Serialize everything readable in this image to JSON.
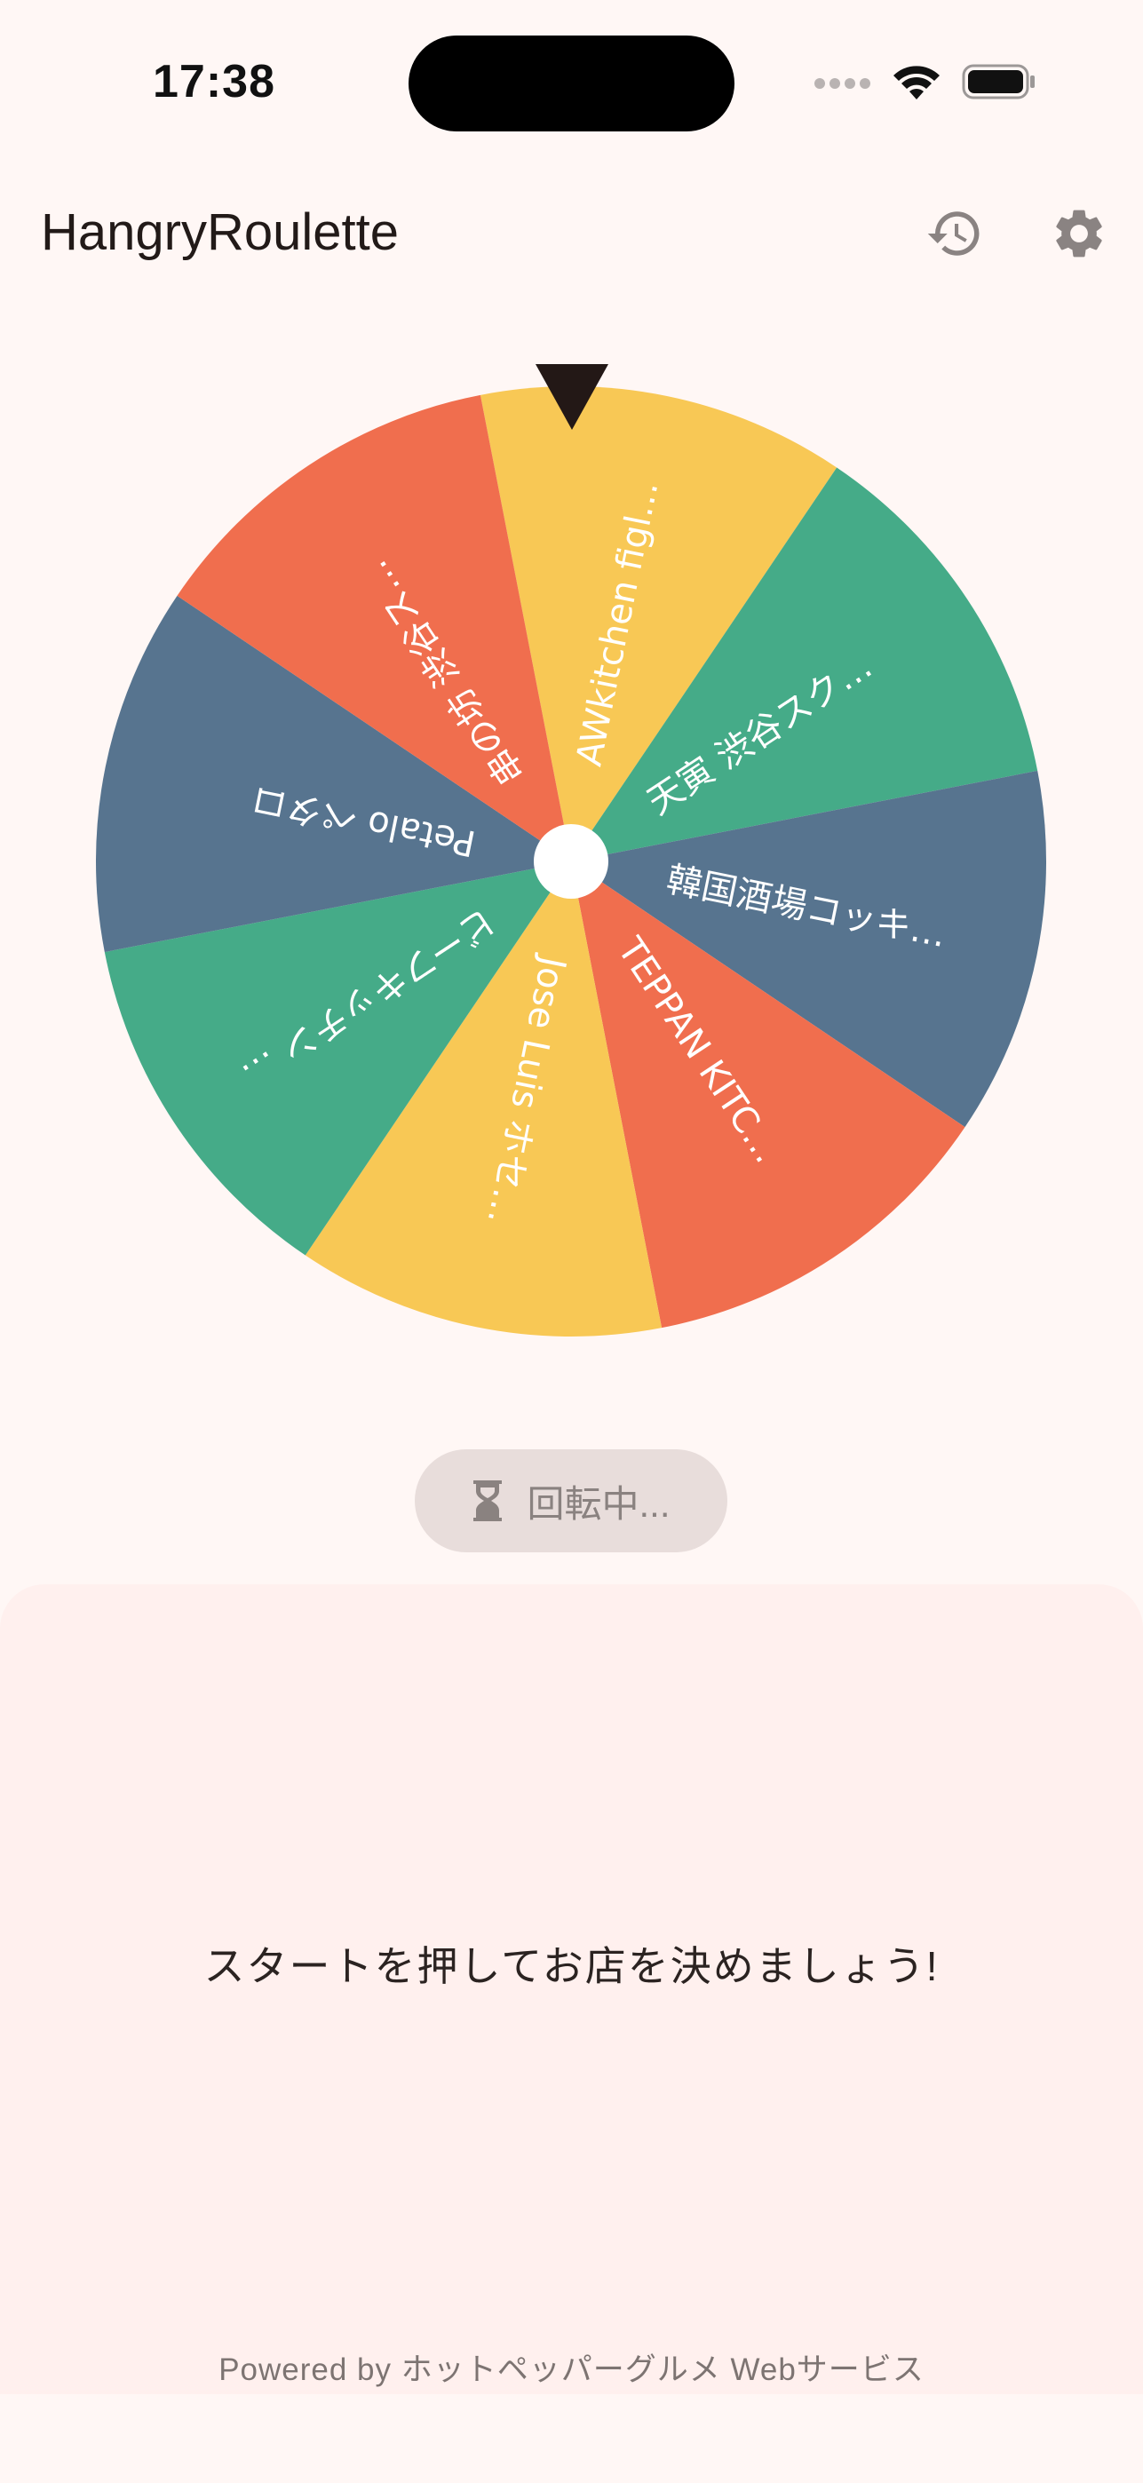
{
  "status_bar": {
    "time": "17:38"
  },
  "app_bar": {
    "title": "HangryRoulette",
    "history_icon": "history-icon",
    "settings_icon": "gear-icon"
  },
  "wheel": {
    "colors": {
      "yellow": "#f8c855",
      "green": "#45ab88",
      "blue": "#57748f",
      "orange": "#f06e4e",
      "pointer": "#231816",
      "hub": "#ffffff"
    },
    "segments": [
      {
        "label": "AWkitchen figl…",
        "color": "#f8c855"
      },
      {
        "label": "天寅 渋谷スク…",
        "color": "#45ab88"
      },
      {
        "label": "韓国酒場コッキ…",
        "color": "#57748f"
      },
      {
        "label": "TEPPAN KITC…",
        "color": "#f06e4e"
      },
      {
        "label": "Jose Luis ホセ…",
        "color": "#f8c855"
      },
      {
        "label": "ビーフキッチン …",
        "color": "#45ab88"
      },
      {
        "label": "Petalo ペタロ",
        "color": "#57748f"
      },
      {
        "label": "串の坊 渋谷ス…",
        "color": "#f06e4e"
      }
    ]
  },
  "spin_button": {
    "label": "回転中...",
    "icon": "hourglass-icon"
  },
  "result": {
    "message": "スタートを押してお店を決めましょう!"
  },
  "footer": {
    "credit": "Powered by ホットペッパーグルメ Webサービス"
  }
}
